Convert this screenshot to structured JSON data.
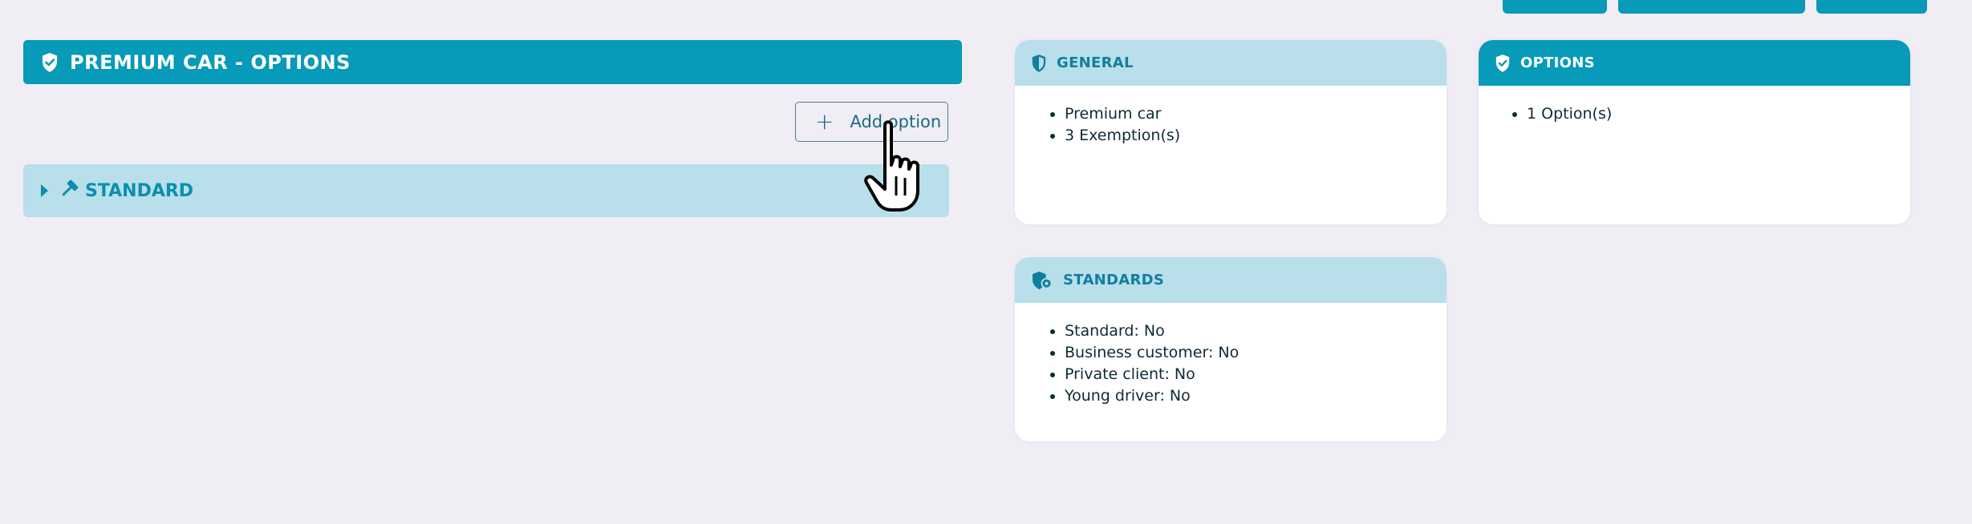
{
  "top_buttons": [
    "",
    "",
    ""
  ],
  "left_panel": {
    "title": "PREMIUM CAR - OPTIONS",
    "add_option_label": "Add option",
    "accordion": {
      "label": "STANDARD"
    }
  },
  "cards": {
    "general": {
      "title": "GENERAL",
      "items": [
        "Premium car",
        "3 Exemption(s)"
      ]
    },
    "options": {
      "title": "OPTIONS",
      "items": [
        "1 Option(s)"
      ]
    },
    "standards": {
      "title": "STANDARDS",
      "items": [
        {
          "label": "Standard:",
          "value": "No"
        },
        {
          "label": "Business customer:",
          "value": "No"
        },
        {
          "label": "Private client:",
          "value": "No"
        },
        {
          "label": "Young driver:",
          "value": "No"
        }
      ]
    }
  },
  "colors": {
    "primary": "#079ab9",
    "light": "#b8dfea",
    "background": "#f1edf5",
    "text": "#0d2a38"
  },
  "icons": {
    "header": "shield-check-icon",
    "accordion": "hammer-icon",
    "general": "shield-icon",
    "options": "shield-check-icon",
    "standards": "shield-gear-icon",
    "cursor": "hand-pointer-icon"
  }
}
